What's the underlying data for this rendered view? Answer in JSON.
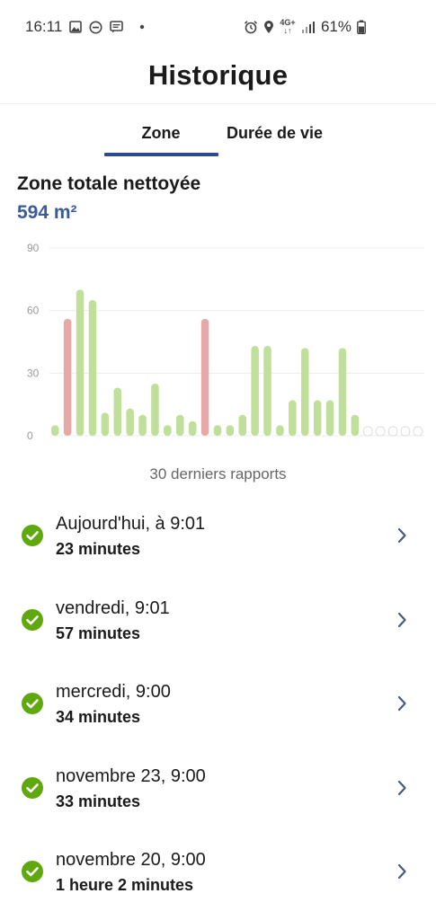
{
  "status_bar": {
    "time": "16:11",
    "battery_percent": "61%",
    "network": "4G+",
    "icons_left": [
      "gallery-icon",
      "dnd-icon",
      "message-icon",
      "dot-icon"
    ],
    "icons_right": [
      "alarm-icon",
      "location-icon",
      "network-icon",
      "signal-icon",
      "battery-icon"
    ]
  },
  "header": {
    "title": "Historique"
  },
  "tabs": [
    {
      "label": "Zone",
      "active": true
    },
    {
      "label": "Durée de vie",
      "active": false
    }
  ],
  "summary": {
    "label": "Zone totale nettoyée",
    "value": "594 m²"
  },
  "chart_data": {
    "type": "bar",
    "ylim": [
      0,
      90
    ],
    "yticks": [
      0,
      30,
      60,
      90
    ],
    "grid": true,
    "values": [
      5,
      56,
      70,
      65,
      11,
      23,
      13,
      10,
      25,
      5,
      10,
      7,
      56,
      5,
      5,
      10,
      43,
      43,
      5,
      17,
      42,
      17,
      17,
      42,
      10,
      0,
      0,
      0,
      0,
      0
    ],
    "colors": [
      "green",
      "red",
      "green",
      "green",
      "green",
      "green",
      "green",
      "green",
      "green",
      "green",
      "green",
      "green",
      "red",
      "green",
      "green",
      "green",
      "green",
      "green",
      "green",
      "green",
      "green",
      "green",
      "green",
      "green",
      "green",
      "empty",
      "empty",
      "empty",
      "empty",
      "empty"
    ],
    "palette": {
      "green": "#bfdf9a",
      "red": "#e6a9a8",
      "empty": "#e2e2e2",
      "grid": "#ececec",
      "tick": "#9a9a9a"
    },
    "caption": "30 derniers rapports"
  },
  "reports": [
    {
      "date": "Aujourd'hui, à 9:01",
      "duration": "23 minutes"
    },
    {
      "date": "vendredi, 9:01",
      "duration": "57 minutes"
    },
    {
      "date": "mercredi, 9:00",
      "duration": "34 minutes"
    },
    {
      "date": "novembre 23, 9:00",
      "duration": "33 minutes"
    },
    {
      "date": "novembre 20, 9:00",
      "duration": "1 heure 2 minutes"
    }
  ],
  "colors": {
    "accent": "#2e4a8f",
    "value": "#3a5a9a",
    "success": "#5fa90f",
    "chevron": "#4a5a7a"
  }
}
